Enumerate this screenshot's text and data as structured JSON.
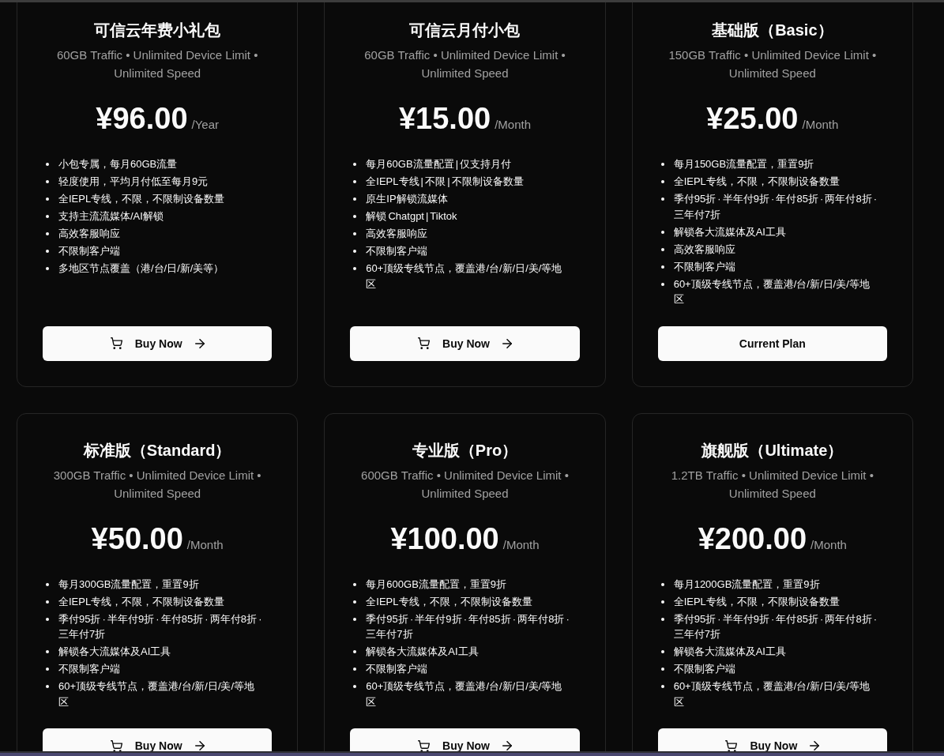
{
  "plans": [
    {
      "title": "可信云年费小礼包",
      "subtitle": "60GB Traffic • Unlimited Device Limit • Unlimited Speed",
      "price": "¥96.00",
      "period": "/Year",
      "features": [
        "小包专属，每月60GB流量",
        "轻度使用，平均月付低至每月9元",
        "全IEPL专线，不限，不限制设备数量",
        "支持主流流媒体/AI解锁",
        "高效客服响应",
        "不限制客户端",
        "多地区节点覆盖（港/台/日/新/美等）"
      ],
      "button": {
        "label": "Buy Now",
        "kind": "buy"
      }
    },
    {
      "title": "可信云月付小包",
      "subtitle": "60GB Traffic • Unlimited Device Limit • Unlimited Speed",
      "price": "¥15.00",
      "period": "/Month",
      "features": [
        "每月60GB流量配置 | 仅支持月付",
        "全IEPL专线 | 不限 | 不限制设备数量",
        "原生IP解锁流媒体",
        "解锁 Chatgpt | Tiktok",
        "高效客服响应",
        "不限制客户端",
        "60+顶级专线节点，覆盖港/台/新/日/美/等地区"
      ],
      "button": {
        "label": "Buy Now",
        "kind": "buy"
      }
    },
    {
      "title": "基础版（Basic）",
      "subtitle": "150GB Traffic • Unlimited Device Limit • Unlimited Speed",
      "price": "¥25.00",
      "period": "/Month",
      "features": [
        "每月150GB流量配置，重置9折",
        "全IEPL专线，不限，不限制设备数量",
        "季付95折 · 半年付9折 · 年付85折 · 两年付8折 · 三年付7折",
        "解锁各大流媒体及AI工具",
        "高效客服响应",
        "不限制客户端",
        "60+顶级专线节点，覆盖港/台/新/日/美/等地区"
      ],
      "button": {
        "label": "Current Plan",
        "kind": "current"
      }
    },
    {
      "title": "标准版（Standard）",
      "subtitle": "300GB Traffic • Unlimited Device Limit • Unlimited Speed",
      "price": "¥50.00",
      "period": "/Month",
      "features": [
        "每月300GB流量配置，重置9折",
        "全IEPL专线，不限，不限制设备数量",
        "季付95折 · 半年付9折 · 年付85折 · 两年付8折 · 三年付7折",
        "解锁各大流媒体及AI工具",
        "不限制客户端",
        "60+顶级专线节点，覆盖港/台/新/日/美/等地区"
      ],
      "button": {
        "label": "Buy Now",
        "kind": "buy"
      }
    },
    {
      "title": "专业版（Pro）",
      "subtitle": "600GB Traffic • Unlimited Device Limit • Unlimited Speed",
      "price": "¥100.00",
      "period": "/Month",
      "features": [
        "每月600GB流量配置，重置9折",
        "全IEPL专线，不限，不限制设备数量",
        "季付95折 · 半年付9折 · 年付85折 · 两年付8折 · 三年付7折",
        "解锁各大流媒体及AI工具",
        "不限制客户端",
        "60+顶级专线节点，覆盖港/台/新/日/美/等地区"
      ],
      "button": {
        "label": "Buy Now",
        "kind": "buy"
      }
    },
    {
      "title": "旗舰版（Ultimate）",
      "subtitle": "1.2TB Traffic • Unlimited Device Limit • Unlimited Speed",
      "price": "¥200.00",
      "period": "/Month",
      "features": [
        "每月1200GB流量配置，重置9折",
        "全IEPL专线，不限，不限制设备数量",
        "季付95折 · 半年付9折 · 年付85折 · 两年付8折 · 三年付7折",
        "解锁各大流媒体及AI工具",
        "不限制客户端",
        "60+顶级专线节点，覆盖港/台/新/日/美/等地区"
      ],
      "button": {
        "label": "Buy Now",
        "kind": "buy"
      }
    }
  ]
}
